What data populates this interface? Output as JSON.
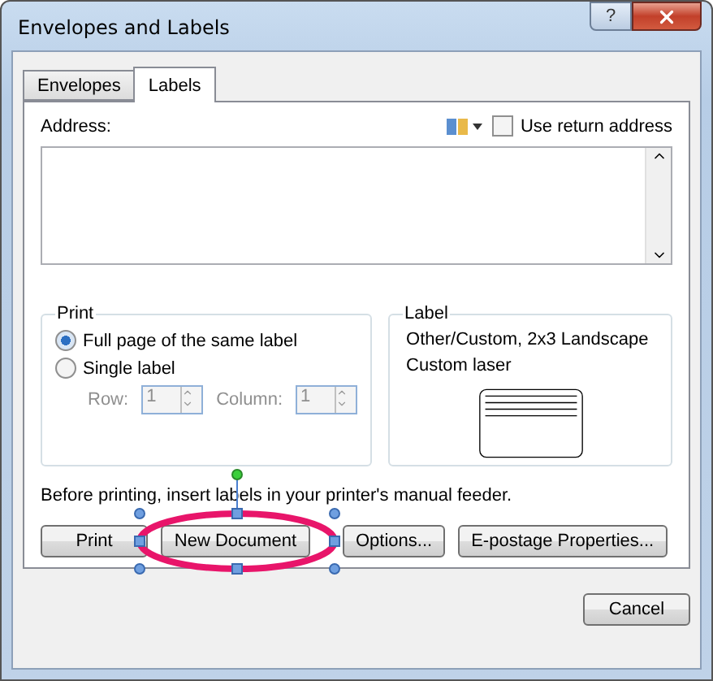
{
  "window": {
    "title": "Envelopes and Labels",
    "help": "?"
  },
  "tabs": [
    {
      "label": "Envelopes",
      "selected": false
    },
    {
      "label": "Labels",
      "selected": true
    }
  ],
  "address": {
    "label": "Address:"
  },
  "use_return_address": {
    "label": "Use return address",
    "checked": false
  },
  "print_group": {
    "title": "Print",
    "options": [
      {
        "label": "Full page of the same label",
        "selected": true
      },
      {
        "label": "Single label",
        "selected": false
      }
    ],
    "spinners": [
      {
        "label": "Row:",
        "value": "1",
        "disabled": true
      },
      {
        "label": "Column:",
        "value": "1",
        "disabled": true
      }
    ]
  },
  "label_group": {
    "title": "Label",
    "lines": [
      "Other/Custom, 2x3 Landscape",
      "Custom laser"
    ]
  },
  "note": "Before printing, insert labels in your printer's manual feeder.",
  "buttons": [
    {
      "label": "Print",
      "highlighted": false
    },
    {
      "label": "New Document",
      "highlighted": true
    },
    {
      "label": "Options...",
      "highlighted": false
    },
    {
      "label": "E-postage Properties...",
      "highlighted": false
    }
  ],
  "cancel": "Cancel"
}
